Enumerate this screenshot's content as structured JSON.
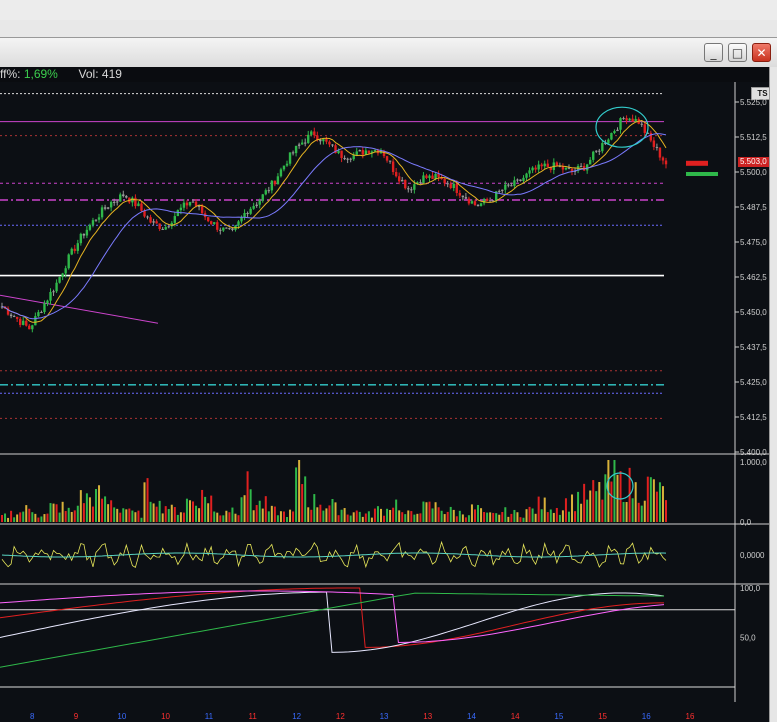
{
  "window": {
    "buttons": {
      "minimize": "_",
      "maximize": "□",
      "close": "✕"
    }
  },
  "info": {
    "diff_label": "ff%:",
    "diff_value": "1,69%",
    "vol_label": "Vol:",
    "vol_value": "419"
  },
  "badge_ts": "TS",
  "current_price": "5.503,0",
  "colors": {
    "background": "#0c0f14",
    "up": "#2fb84a",
    "down": "#e02020",
    "neutral": "#9a9a9a",
    "ma_fast": "#e6b422",
    "ma_slow": "#7b7bff",
    "resistance": "#cc44cc",
    "support": "#ffffff"
  },
  "price_axis": [
    "5.525,0",
    "5.512,5",
    "5.500,0",
    "5.487,5",
    "5.475,0",
    "5.462,5",
    "5.450,0",
    "5.437,5",
    "5.425,0",
    "5.412,5",
    "5.400,0"
  ],
  "volume_axis": [
    "1.000,0",
    "0,0"
  ],
  "osc_axis": [
    "0,0000"
  ],
  "stoch_axis": [
    "100,0",
    "50,0"
  ],
  "x_axis": [
    {
      "label": "8",
      "color": "#3a6bff"
    },
    {
      "label": "9",
      "color": "#ff3030"
    },
    {
      "label": "10",
      "color": "#3a6bff"
    },
    {
      "label": "10",
      "color": "#ff3030"
    },
    {
      "label": "11",
      "color": "#3a6bff"
    },
    {
      "label": "11",
      "color": "#ff3030"
    },
    {
      "label": "12",
      "color": "#3a6bff"
    },
    {
      "label": "12",
      "color": "#ff3030"
    },
    {
      "label": "13",
      "color": "#3a6bff"
    },
    {
      "label": "13",
      "color": "#ff3030"
    },
    {
      "label": "14",
      "color": "#3a6bff"
    },
    {
      "label": "14",
      "color": "#ff3030"
    },
    {
      "label": "15",
      "color": "#3a6bff"
    },
    {
      "label": "15",
      "color": "#ff3030"
    },
    {
      "label": "16",
      "color": "#3a6bff"
    },
    {
      "label": "16",
      "color": "#ff3030"
    }
  ],
  "chart_data": {
    "type": "line",
    "price_range": [
      5400,
      5530
    ],
    "close_path": [
      5452,
      5448,
      5444,
      5452,
      5460,
      5470,
      5478,
      5484,
      5489,
      5492,
      5488,
      5482,
      5480,
      5486,
      5490,
      5484,
      5480,
      5478,
      5486,
      5490,
      5496,
      5504,
      5510,
      5514,
      5510,
      5506,
      5506,
      5508,
      5508,
      5500,
      5494,
      5498,
      5498,
      5496,
      5492,
      5488,
      5490,
      5494,
      5496,
      5500,
      5502,
      5502,
      5500,
      5502,
      5508,
      5514,
      5520,
      5518,
      5510,
      5503
    ],
    "volume_range": [
      0,
      1000
    ],
    "volume": [
      120,
      180,
      250,
      140,
      300,
      220,
      480,
      520,
      390,
      280,
      160,
      600,
      330,
      240,
      420,
      510,
      180,
      260,
      700,
      350,
      220,
      180,
      900,
      410,
      330,
      270,
      200,
      150,
      240,
      380,
      160,
      290,
      310,
      220,
      180,
      260,
      140,
      200,
      170,
      240,
      350,
      280,
      400,
      520,
      600,
      880,
      760,
      640,
      720,
      580
    ]
  }
}
